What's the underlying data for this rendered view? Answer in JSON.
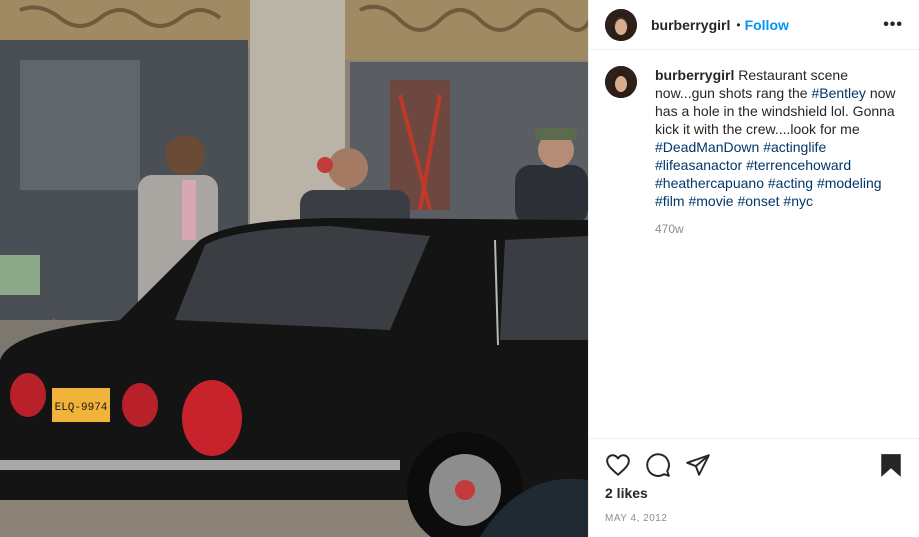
{
  "post": {
    "username": "burberrygirl",
    "follow_label": "Follow",
    "separator": "•",
    "more_label": "•••",
    "caption_username": "burberrygirl",
    "caption_parts": [
      {
        "text": " Restaurant scene now...gun shots rang the ",
        "tag": false
      },
      {
        "text": "#Bentley",
        "tag": true
      },
      {
        "text": " now has a hole in the windshield lol. Gonna kick it with the crew....look for me ",
        "tag": false
      },
      {
        "text": "#DeadManDown",
        "tag": true
      },
      {
        "text": " ",
        "tag": false
      },
      {
        "text": "#actinglife",
        "tag": true
      },
      {
        "text": " ",
        "tag": false
      },
      {
        "text": "#lifeasanactor",
        "tag": true
      },
      {
        "text": " ",
        "tag": false
      },
      {
        "text": "#terrencehoward",
        "tag": true
      },
      {
        "text": " ",
        "tag": false
      },
      {
        "text": "#heathercapuano",
        "tag": true
      },
      {
        "text": " ",
        "tag": false
      },
      {
        "text": "#acting",
        "tag": true
      },
      {
        "text": " ",
        "tag": false
      },
      {
        "text": "#modeling",
        "tag": true
      },
      {
        "text": " ",
        "tag": false
      },
      {
        "text": "#film",
        "tag": true
      },
      {
        "text": " ",
        "tag": false
      },
      {
        "text": "#movie",
        "tag": true
      },
      {
        "text": " ",
        "tag": false
      },
      {
        "text": "#onset",
        "tag": true
      },
      {
        "text": " ",
        "tag": false
      },
      {
        "text": "#nyc",
        "tag": true
      }
    ],
    "age": "470w",
    "likes": "2 likes",
    "date": "MAY 4, 2012",
    "license_plate": "ELQ-9974"
  },
  "icons": {
    "like": "heart-icon",
    "comment": "comment-icon",
    "share": "share-icon",
    "save": "bookmark-icon",
    "more": "more-icon"
  },
  "colors": {
    "link": "#0095f6",
    "hashtag": "#00376b",
    "muted": "#8e8e8e",
    "text": "#262626"
  }
}
